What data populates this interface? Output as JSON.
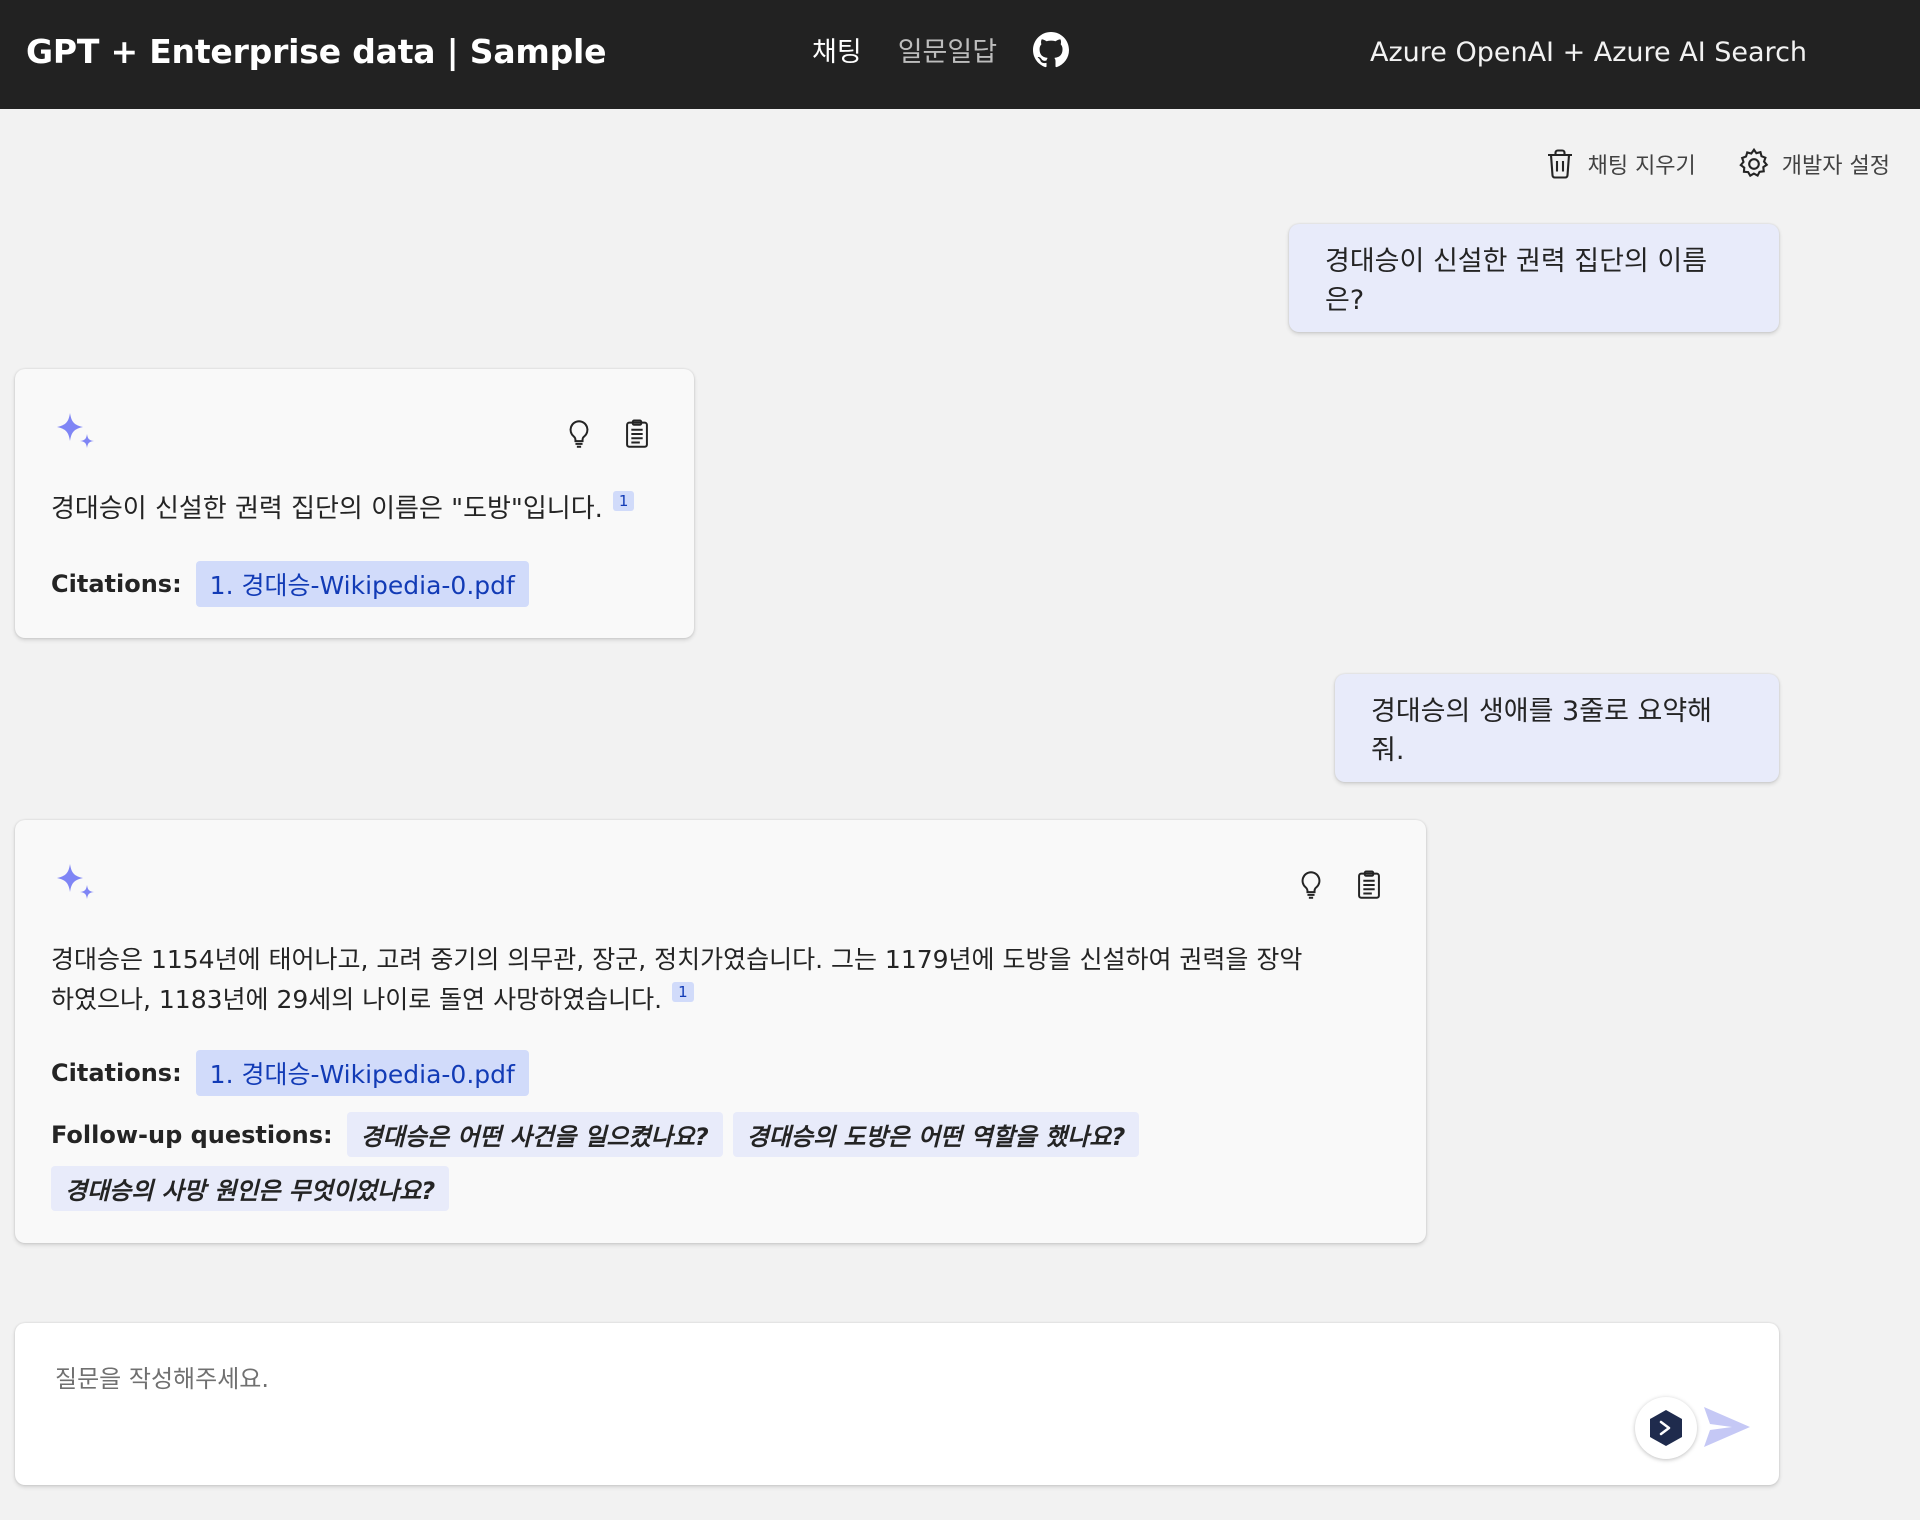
{
  "header": {
    "brand": "GPT + Enterprise data | Sample",
    "nav": [
      {
        "label": "채팅",
        "active": true
      },
      {
        "label": "일문일답",
        "active": false
      }
    ],
    "github_icon": "github-icon",
    "right_text": "Azure OpenAI + Azure AI Search"
  },
  "toolbar": {
    "clear_label": "채팅 지우기",
    "clear_icon": "trash-icon",
    "settings_label": "개발자 설정",
    "settings_icon": "gear-icon"
  },
  "messages": [
    {
      "role": "user",
      "text": "경대승이 신설한 권력 집단의 이름은?"
    },
    {
      "role": "assistant",
      "text": "경대승이 신설한 권력 집단의 이름은 \"도방\"입니다.",
      "citation_marker": "1",
      "citations_label": "Citations:",
      "citations": [
        "1. 경대승-Wikipedia-0.pdf"
      ]
    },
    {
      "role": "user",
      "text": "경대승의 생애를 3줄로 요약해줘."
    },
    {
      "role": "assistant",
      "text_line1": "경대승은 1154년에 태어나고, 고려 중기의 의무관, 장군, 정치가였습니다. 그는 1179년에 도방을 신설하여 권력을 장악",
      "text_line2": "하였으나, 1183년에 29세의 나이로 돌연 사망하였습니다.",
      "citation_marker": "1",
      "citations_label": "Citations:",
      "citations": [
        "1. 경대승-Wikipedia-0.pdf"
      ],
      "followup_label": "Follow-up questions:",
      "followups": [
        "경대승은 어떤 사건을 일으켰나요?",
        "경대승의 도방은 어떤 역할을 했나요?",
        "경대승의 사망 원인은 무엇이었나요?"
      ]
    }
  ],
  "composer": {
    "placeholder": "질문을 작성해주세요."
  },
  "colors": {
    "header_bg": "#222222",
    "page_bg": "#f2f2f2",
    "user_bubble": "#e8ebfa",
    "citation_chip": "#d1dbfa",
    "accent": "#7f85f5"
  }
}
